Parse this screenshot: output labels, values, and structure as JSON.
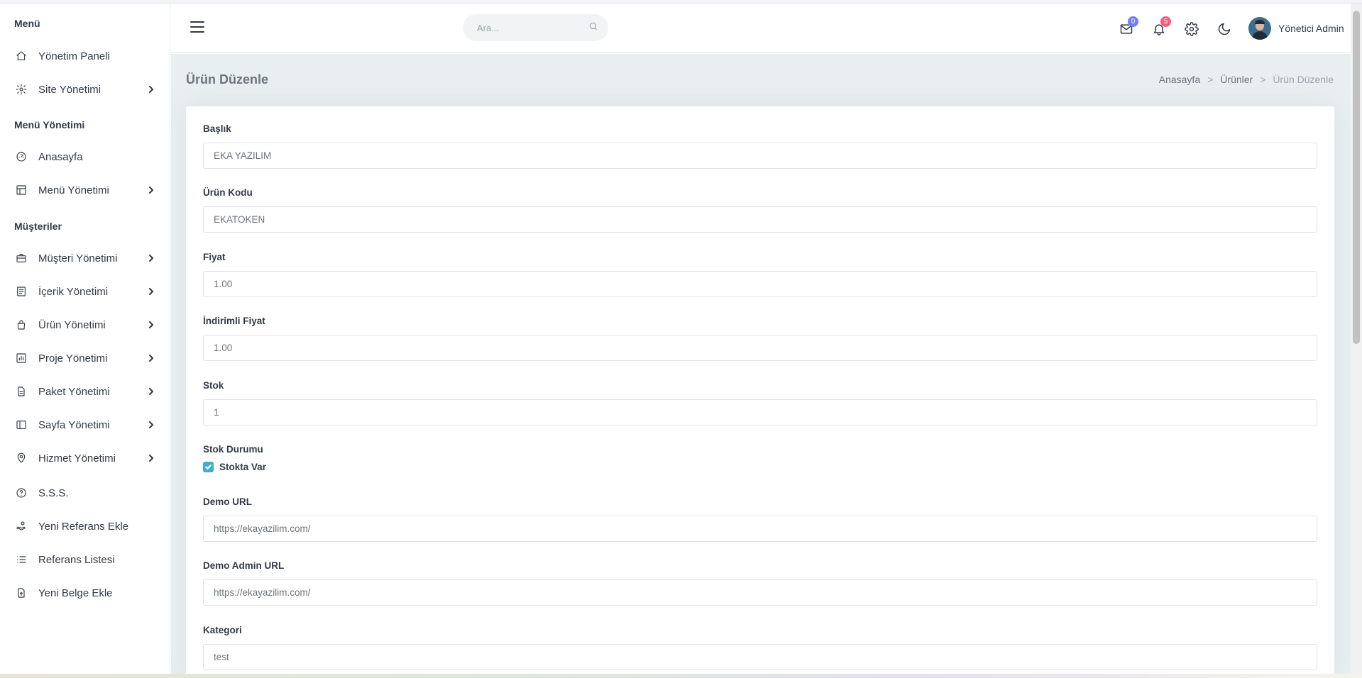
{
  "sidebar": {
    "sections": [
      {
        "title": "Menü"
      },
      {
        "title": "Menü Yönetimi"
      },
      {
        "title": "Müşteriler"
      }
    ],
    "items": [
      {
        "label": "Yönetim Paneli",
        "icon": "home-icon"
      },
      {
        "label": "Site Yönetimi",
        "icon": "gear-icon"
      },
      {
        "label": "Anasayfa",
        "icon": "dashboard-icon"
      },
      {
        "label": "Menü Yönetimi",
        "icon": "layout-icon"
      },
      {
        "label": "Müşteri Yönetimi",
        "icon": "briefcase-icon"
      },
      {
        "label": "İçerik Yönetimi",
        "icon": "content-icon"
      },
      {
        "label": "Ürün Yönetimi",
        "icon": "shopping-bag-icon"
      },
      {
        "label": "Proje Yönetimi",
        "icon": "bar-chart-icon"
      },
      {
        "label": "Paket Yönetimi",
        "icon": "file-icon"
      },
      {
        "label": "Sayfa Yönetimi",
        "icon": "sidebar-layout-icon"
      },
      {
        "label": "Hizmet Yönetimi",
        "icon": "map-pin-icon"
      },
      {
        "label": "S.S.S.",
        "icon": "help-circle-icon"
      },
      {
        "label": "Yeni Referans Ekle",
        "icon": "hand-coins-icon"
      },
      {
        "label": "Referans Listesi",
        "icon": "list-icon"
      },
      {
        "label": "Yeni Belge Ekle",
        "icon": "file-upload-icon"
      }
    ]
  },
  "topbar": {
    "search_placeholder": "Ara...",
    "mail_count": "0",
    "notification_count": "5",
    "user_name": "Yönetici Admin",
    "colors": {
      "mail_badge": "#727cf5",
      "notification_badge": "#fa5c7c"
    }
  },
  "page": {
    "title": "Ürün Düzenle",
    "breadcrumb": [
      "Anasayfa",
      "Ürünler",
      "Ürün Düzenle"
    ]
  },
  "form": {
    "baslik": {
      "label": "Başlık",
      "value": "EKA YAZILIM"
    },
    "urun_kodu": {
      "label": "Ürün Kodu",
      "value": "EKATOKEN"
    },
    "fiyat": {
      "label": "Fiyat",
      "value": "1.00"
    },
    "indirimli_fiyat": {
      "label": "İndirimli Fiyat",
      "value": "1.00"
    },
    "stok": {
      "label": "Stok",
      "value": "1"
    },
    "stok_durumu": {
      "label": "Stok Durumu",
      "checkbox_label": "Stokta Var",
      "checked": true
    },
    "demo_url": {
      "label": "Demo URL",
      "value": "https://ekayazilim.com/"
    },
    "demo_admin_url": {
      "label": "Demo Admin URL",
      "value": "https://ekayazilim.com/"
    },
    "kategori": {
      "label": "Kategori",
      "value": "test"
    }
  },
  "colors": {
    "accent": "#39afd1",
    "content_bg": "#e9eff1"
  }
}
